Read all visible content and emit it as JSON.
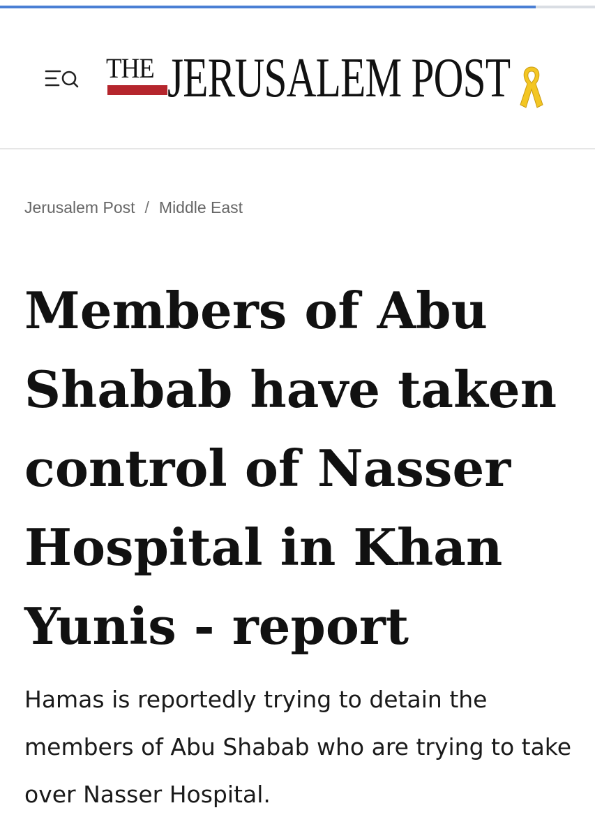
{
  "page_load": {
    "progress": 0.9,
    "bar_color": "#4a7fd4",
    "track_color": "#d9dde3"
  },
  "header": {
    "menu_icon": "menu-search-icon",
    "logo": {
      "the_text": "THE",
      "main_text": "JERUSALEM POST",
      "accent_color": "#b5262d",
      "ribbon_icon": "yellow-ribbon-icon",
      "ribbon_color": "#f3c623"
    }
  },
  "breadcrumb": {
    "items": [
      "Jerusalem Post",
      "Middle East"
    ],
    "separator": "/"
  },
  "article": {
    "headline": "Members of Abu Shabab have taken control of Nasser Hospital in Khan Yunis - report",
    "subheadline": "Hamas is reportedly trying to detain the members of Abu Shabab who are trying to take over Nasser Hospital."
  }
}
